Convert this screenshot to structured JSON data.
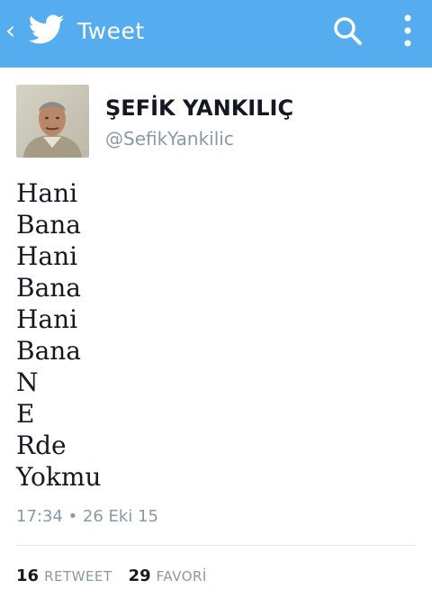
{
  "colors": {
    "topbar": "#55acee",
    "text": "#141823",
    "secondary_text": "#8899a6",
    "divider": "#e1e8ed"
  },
  "header": {
    "back_icon": "chevron-left-icon",
    "logo_icon": "twitter-bird-icon",
    "title": "Tweet",
    "search_icon": "search-icon",
    "overflow_icon": "overflow-menu-icon"
  },
  "author": {
    "display_name": "ŞEFİK YANKILIÇ",
    "handle": "@SefikYankilic"
  },
  "tweet": {
    "lines": [
      "Hani",
      "Bana",
      "Hani",
      "Bana",
      "Hani",
      "Bana",
      "N",
      "E",
      "Rde",
      "Yokmu"
    ],
    "timestamp": "17:34 • 26 Eki 15"
  },
  "stats": {
    "retweet_count": "16",
    "retweet_label": "RETWEET",
    "favorite_count": "29",
    "favorite_label": "FAVORİ"
  }
}
